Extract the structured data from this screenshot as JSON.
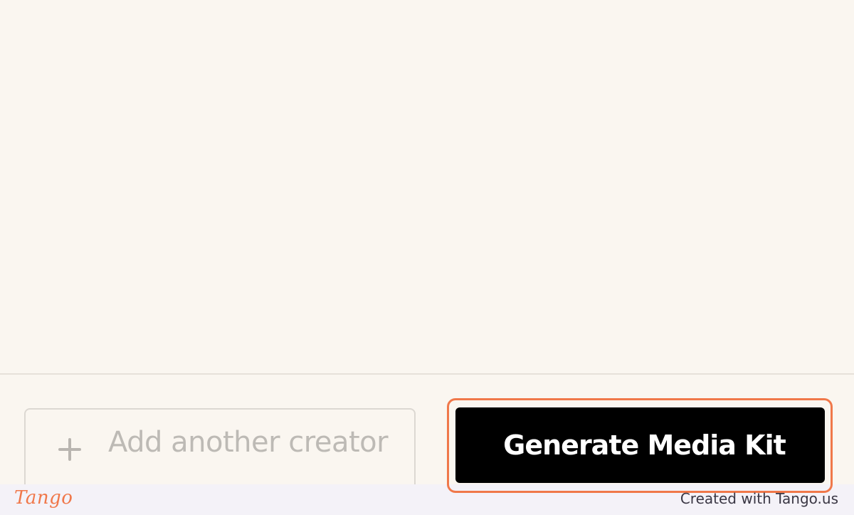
{
  "footer": {
    "add_creator_label": "Add another creator",
    "add_creator_icon": "plus-icon",
    "generate_label": "Generate Media Kit"
  },
  "tango": {
    "logo_text": "Tango",
    "credit_text": "Created with Tango.us"
  },
  "colors": {
    "surface": "#faf6f0",
    "primary_button": "#000000",
    "highlight": "#f0784a",
    "muted_text": "#bdbab5"
  }
}
